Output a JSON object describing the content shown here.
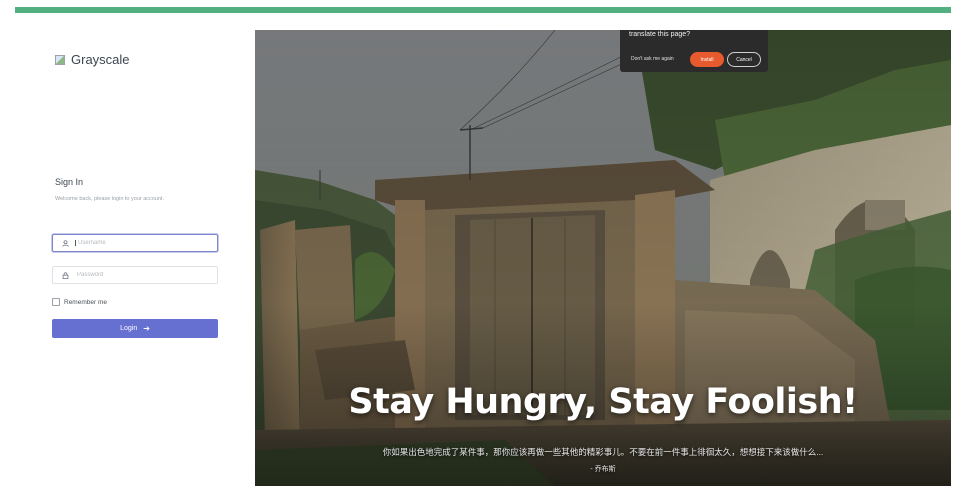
{
  "app": {
    "logo_text": "Grayscale"
  },
  "login": {
    "title": "Sign In",
    "subtitle": "Welcome back, please login to your account.",
    "username_placeholder": "Username",
    "password_placeholder": "Password",
    "remember_label": "Remember me",
    "login_label": "Login"
  },
  "hero": {
    "title": "Stay Hungry, Stay Foolish!",
    "text": "你如果出色地完成了某件事，那你应该再做一些其他的精彩事儿。不要在前一件事上徘徊太久，想想接下来该做什么...",
    "author": "- 乔布斯"
  },
  "translate_popup": {
    "title": "translate this page?",
    "dont_ask_label": "Don't ask me again",
    "install_label": "Install",
    "cancel_label": "Cancel"
  },
  "colors": {
    "accent_bar": "#52b080",
    "primary_button": "#6670d0",
    "install_button": "#e65a2d"
  }
}
